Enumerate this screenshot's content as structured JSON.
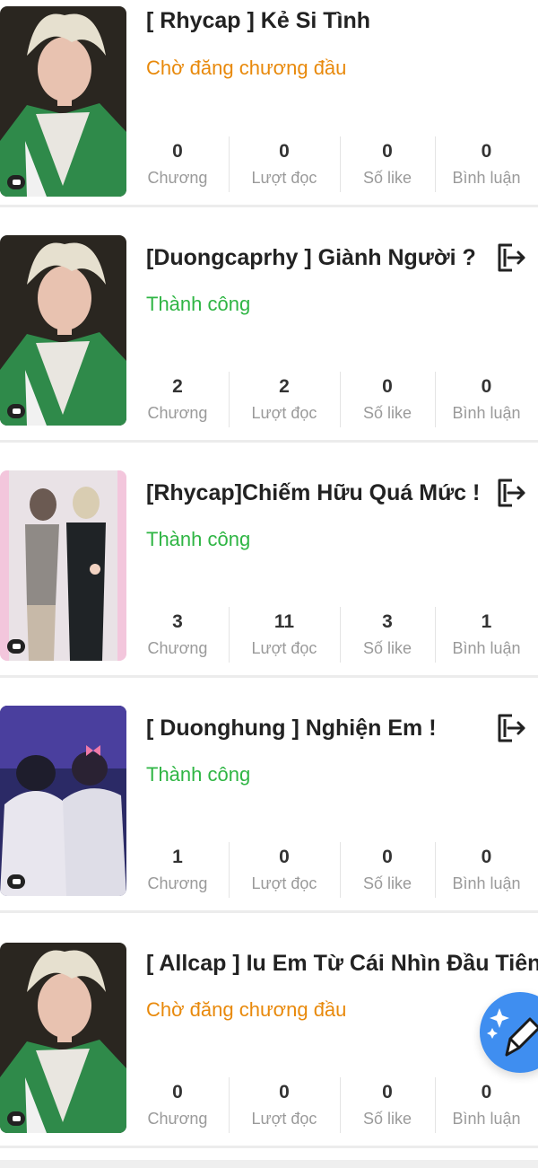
{
  "stats_labels": [
    "Chương",
    "Lượt đọc",
    "Số like",
    "Bình luận"
  ],
  "stories": [
    {
      "title": "[ Rhycap ] Kẻ Si Tình",
      "status": "Chờ đăng chương đầu",
      "status_type": "pending",
      "exit_icon": false,
      "cover": "blonde-man-green-jacket",
      "stats": [
        "0",
        "0",
        "0",
        "0"
      ]
    },
    {
      "title": "[Duongcaprhy ] Giành Người ?",
      "status": "Thành công",
      "status_type": "ok",
      "exit_icon": true,
      "cover": "blonde-man-green-jacket",
      "stats": [
        "2",
        "2",
        "0",
        "0"
      ]
    },
    {
      "title": "[Rhycap]Chiếm Hữu Quá Mức !",
      "status": "Thành công",
      "status_type": "ok",
      "exit_icon": true,
      "cover": "two-men-standing-pink-frame",
      "stats": [
        "3",
        "11",
        "3",
        "1"
      ]
    },
    {
      "title": "[ Duonghung ] Nghiện Em !",
      "status": "Thành công",
      "status_type": "ok",
      "exit_icon": true,
      "cover": "two-men-stage-blue-light",
      "stats": [
        "1",
        "0",
        "0",
        "0"
      ]
    },
    {
      "title": "[ Allcap ] Iu Em Từ Cái Nhìn Đầu Tiên",
      "status": "Chờ đăng chương đầu",
      "status_type": "pending",
      "exit_icon": false,
      "cover": "blonde-man-green-jacket",
      "stats": [
        "0",
        "0",
        "0",
        "0"
      ]
    }
  ],
  "fab_icon": "pencil-sparkle-icon",
  "colors": {
    "pending": "#e8890b",
    "ok": "#2fb544",
    "fab": "#3f8ef0"
  }
}
